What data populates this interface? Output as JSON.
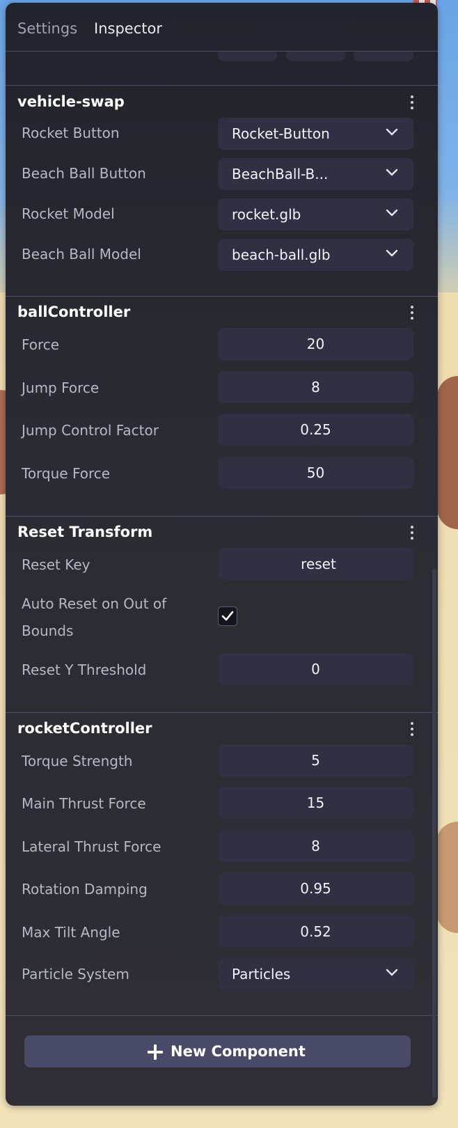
{
  "tabs": [
    {
      "label": "Settings",
      "active": false
    },
    {
      "label": "Inspector",
      "active": true
    }
  ],
  "sections": {
    "vehicle_swap": {
      "title": "vehicle-swap",
      "rows": [
        {
          "label": "Rocket Button",
          "value": "Rocket-Button"
        },
        {
          "label": "Beach Ball Button",
          "value": "BeachBall-B..."
        },
        {
          "label": "Rocket Model",
          "value": "rocket.glb"
        },
        {
          "label": "Beach Ball Model",
          "value": "beach-ball.glb"
        }
      ]
    },
    "ball_controller": {
      "title": "ballController",
      "rows": [
        {
          "label": "Force",
          "value": "20"
        },
        {
          "label": "Jump Force",
          "value": "8"
        },
        {
          "label": "Jump Control Factor",
          "value": "0.25"
        },
        {
          "label": "Torque Force",
          "value": "50"
        }
      ]
    },
    "reset_transform": {
      "title": "Reset Transform",
      "reset_key": {
        "label": "Reset Key",
        "value": "reset"
      },
      "auto_reset": {
        "label_line1": "Auto Reset on Out of",
        "label_line2": "Bounds",
        "checked": true
      },
      "threshold": {
        "label": "Reset Y Threshold",
        "value": "0"
      }
    },
    "rocket_controller": {
      "title": "rocketController",
      "rows": [
        {
          "label": "Torque Strength",
          "value": "5"
        },
        {
          "label": "Main Thrust Force",
          "value": "15"
        },
        {
          "label": "Lateral Thrust Force",
          "value": "8"
        },
        {
          "label": "Rotation Damping",
          "value": "0.95"
        },
        {
          "label": "Max Tilt Angle",
          "value": "0.52"
        },
        {
          "label": "Particle System",
          "value": "Particles"
        }
      ]
    }
  },
  "new_component_label": "New Component",
  "icons": {
    "dropdown": "chevron-down-icon",
    "menu": "kebab-menu-icon",
    "check": "checkmark-icon",
    "add": "plus-icon"
  },
  "colors": {
    "panel_bg": "#2a2a33",
    "field_bg": "#2f3043",
    "button_bg": "#484a68",
    "label_text": "#b6b8c6",
    "divider": "#4f5168"
  }
}
